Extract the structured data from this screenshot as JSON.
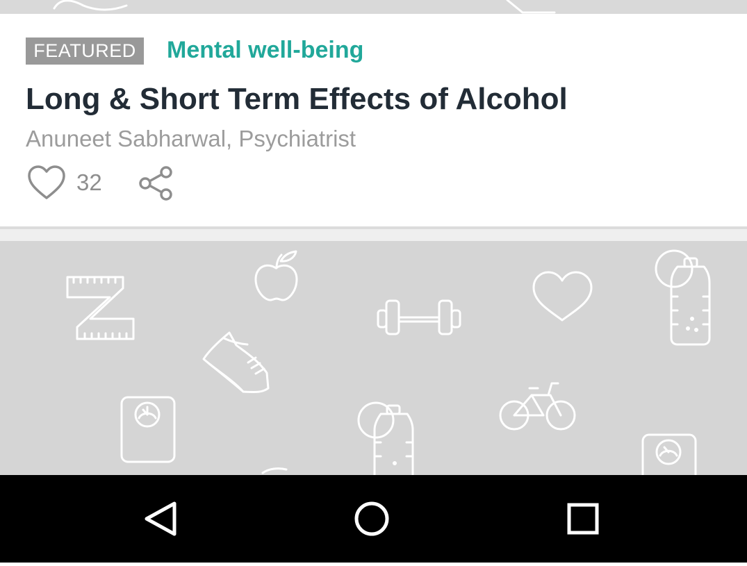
{
  "article": {
    "badge": "FEATURED",
    "category": "Mental well-being",
    "title": "Long & Short Term Effects of Alcohol",
    "author": "Anuneet Sabharwal, Psychiatrist",
    "like_count": "32"
  },
  "icons": {
    "like": "heart-outline-icon",
    "share": "share-icon",
    "banner_pattern": [
      "tape-measure-icon",
      "apple-icon",
      "dumbbell-icon",
      "heart-icon",
      "water-bottle-icon",
      "sneaker-icon",
      "weighing-scale-icon",
      "bicycle-icon"
    ],
    "nav": [
      "back-triangle-icon",
      "home-circle-icon",
      "recents-square-icon"
    ]
  },
  "colors": {
    "badge_bg": "#999999",
    "category": "#21a89a",
    "title": "#222c36",
    "banner_bg": "#d5d5d5",
    "navbar_bg": "#000000"
  }
}
